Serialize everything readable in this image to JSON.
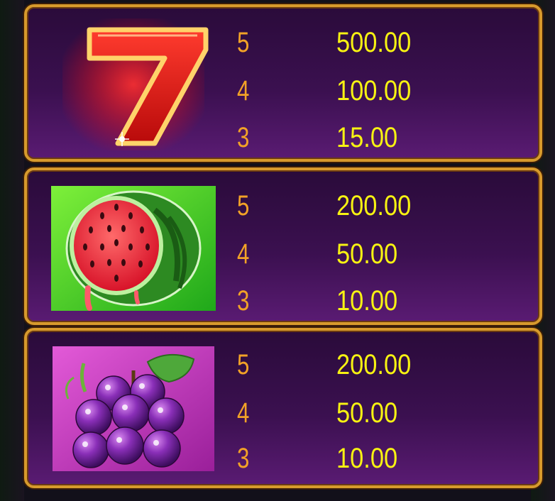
{
  "paytable": [
    {
      "symbol": "seven-icon",
      "payouts": [
        {
          "count": "5",
          "amount": "500.00"
        },
        {
          "count": "4",
          "amount": "100.00"
        },
        {
          "count": "3",
          "amount": "15.00"
        }
      ]
    },
    {
      "symbol": "watermelon-icon",
      "payouts": [
        {
          "count": "5",
          "amount": "200.00"
        },
        {
          "count": "4",
          "amount": "50.00"
        },
        {
          "count": "3",
          "amount": "10.00"
        }
      ]
    },
    {
      "symbol": "grapes-icon",
      "payouts": [
        {
          "count": "5",
          "amount": "200.00"
        },
        {
          "count": "4",
          "amount": "50.00"
        },
        {
          "count": "3",
          "amount": "10.00"
        }
      ]
    }
  ],
  "colors": {
    "frame": "#d79a2c",
    "count_text": "#f2a227",
    "amount_text": "#f7f212",
    "panel_bg": "#3b1050"
  }
}
